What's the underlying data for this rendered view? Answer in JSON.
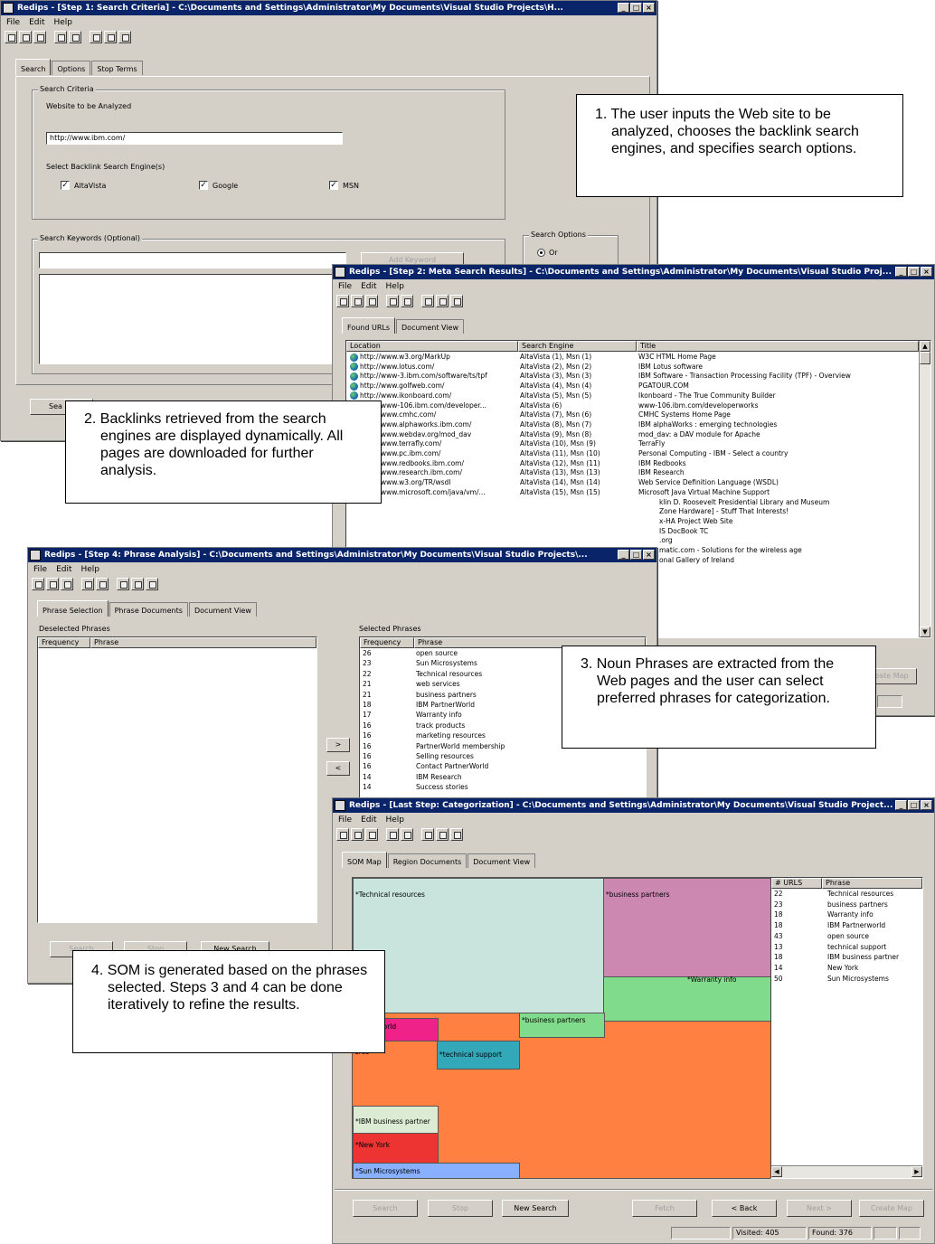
{
  "win1": {
    "title": "Redips - [Step 1: Search Criteria] - C:\\Documents and Settings\\Administrator\\My Documents\\Visual Studio Projects\\H...",
    "menu": [
      "File",
      "Edit",
      "Help"
    ],
    "tabs": [
      "Search",
      "Options",
      "Stop Terms"
    ],
    "criteria_group": "Search Criteria",
    "website_label": "Website to be Analyzed",
    "website_value": "http://www.ibm.com/",
    "engines_label": "Select Backlink Search Engine(s)",
    "engines": [
      "AltaVista",
      "Google",
      "MSN"
    ],
    "keywords_group": "Search Keywords (Optional)",
    "add_keyword": "Add Keyword",
    "options_group": "Search Options",
    "option_or": "Or",
    "bottom_button": "Sea"
  },
  "win2": {
    "title": "Redips - [Step 2: Meta Search Results] - C:\\Documents and Settings\\Administrator\\My Documents\\Visual Studio Proj...",
    "menu": [
      "File",
      "Edit",
      "Help"
    ],
    "tabs": [
      "Found URLs",
      "Document View"
    ],
    "columns": [
      "Location",
      "Search Engine",
      "Title"
    ],
    "rows": [
      {
        "loc": "http://www.w3.org/MarkUp",
        "eng": "AltaVista (1), Msn (1)",
        "title": "W3C HTML Home Page"
      },
      {
        "loc": "http://www.lotus.com/",
        "eng": "AltaVista (2), Msn (2)",
        "title": "IBM Lotus software"
      },
      {
        "loc": "http://www-3.ibm.com/software/ts/tpf",
        "eng": "AltaVista (3), Msn (3)",
        "title": "IBM Software - Transaction Processing Facility (TPF) - Overview"
      },
      {
        "loc": "http://www.golfweb.com/",
        "eng": "AltaVista (4), Msn (4)",
        "title": "PGATOUR.COM"
      },
      {
        "loc": "http://www.ikonboard.com/",
        "eng": "AltaVista (5), Msn (5)",
        "title": "Ikonboard - The True Community Builder"
      },
      {
        "loc": "http://www-106.ibm.com/developer...",
        "eng": "AltaVista (6)",
        "title": "www-106.ibm.com/developerworks"
      },
      {
        "loc": "http://www.cmhc.com/",
        "eng": "AltaVista (7), Msn (6)",
        "title": "CMHC Systems Home Page"
      },
      {
        "loc": "http://www.alphaworks.ibm.com/",
        "eng": "AltaVista (8), Msn (7)",
        "title": "IBM alphaWorks : emerging technologies"
      },
      {
        "loc": "http://www.webdav.org/mod_dav",
        "eng": "AltaVista (9), Msn (8)",
        "title": "mod_dav: a DAV module for Apache"
      },
      {
        "loc": "http://www.terrafly.com/",
        "eng": "AltaVista (10), Msn (9)",
        "title": "TerraFly"
      },
      {
        "loc": "http://www.pc.ibm.com/",
        "eng": "AltaVista (11), Msn (10)",
        "title": "Personal Computing - IBM - Select a country"
      },
      {
        "loc": "http://www.redbooks.ibm.com/",
        "eng": "AltaVista (12), Msn (11)",
        "title": "IBM Redbooks"
      },
      {
        "loc": "http://www.research.ibm.com/",
        "eng": "AltaVista (13), Msn (13)",
        "title": "IBM Research"
      },
      {
        "loc": "http://www.w3.org/TR/wsdl",
        "eng": "AltaVista (14), Msn (14)",
        "title": "Web Service Definition Language (WSDL)"
      },
      {
        "loc": "http://www.microsoft.com/java/vm/...",
        "eng": "AltaVista (15), Msn (15)",
        "title": "Microsoft Java Virtual Machine Support"
      }
    ],
    "more_titles": [
      "klin D. Roosevelt Presidential Library and Museum",
      "Zone Hardware] - Stuff That Interests!",
      "x-HA Project Web Site",
      "IS DocBook TC",
      ".org",
      "matic.com - Solutions for the wireless age",
      "onal Gallery of Ireland"
    ],
    "create_map": "eate Map"
  },
  "win3": {
    "title": "Redips - [Step 4: Phrase Analysis] - C:\\Documents and Settings\\Administrator\\My Documents\\Visual Studio Projects\\...",
    "menu": [
      "File",
      "Edit",
      "Help"
    ],
    "tabs": [
      "Phrase Selection",
      "Phrase Documents",
      "Document View"
    ],
    "deselected_label": "Deselected Phrases",
    "selected_label": "Selected Phrases",
    "columns": [
      "Frequency",
      "Phrase"
    ],
    "selected": [
      {
        "f": "26",
        "p": "open source"
      },
      {
        "f": "23",
        "p": "Sun Microsystems"
      },
      {
        "f": "22",
        "p": "Technical resources"
      },
      {
        "f": "21",
        "p": "web services"
      },
      {
        "f": "21",
        "p": "business partners"
      },
      {
        "f": "18",
        "p": "IBM PartnerWorld"
      },
      {
        "f": "17",
        "p": "Warranty info"
      },
      {
        "f": "16",
        "p": "track products"
      },
      {
        "f": "16",
        "p": "marketing resources"
      },
      {
        "f": "16",
        "p": "PartnerWorld membership"
      },
      {
        "f": "16",
        "p": "Selling resources"
      },
      {
        "f": "16",
        "p": "Contact PartnerWorld"
      },
      {
        "f": "14",
        "p": "IBM Research"
      },
      {
        "f": "14",
        "p": "Success stories"
      }
    ],
    "move_right": ">",
    "move_left": "<",
    "buttons": [
      "Search",
      "Stop",
      "New Search"
    ]
  },
  "win4": {
    "title": "Redips - [Last Step: Categorization] - C:\\Documents and Settings\\Administrator\\My Documents\\Visual Studio Project...",
    "menu": [
      "File",
      "Edit",
      "Help"
    ],
    "tabs": [
      "SOM Map",
      "Region Documents",
      "Document View"
    ],
    "regions": [
      {
        "label": "*Technical resources",
        "color": "#c8e4dc"
      },
      {
        "label": "*business partners",
        "color": "#cc88b0"
      },
      {
        "label": "*Warranty info",
        "color": "#80dc8c"
      },
      {
        "label": "*business partners",
        "color": "#80dc8c"
      },
      {
        "label": "rtnerworld",
        "color": "#ee2288"
      },
      {
        "label": "urce",
        "color": "#ff8040"
      },
      {
        "label": "*technical support",
        "color": "#33a8b8"
      },
      {
        "label": "",
        "color": "#ff8040"
      },
      {
        "label": "*IBM business partner",
        "color": "#dcecd4"
      },
      {
        "label": "*New York",
        "color": "#ee3333"
      },
      {
        "label": "*Sun Microsystems",
        "color": "#88b0ff"
      }
    ],
    "legend_columns": [
      "# URLS",
      "Phrase"
    ],
    "legend": [
      {
        "n": "22",
        "p": "Technical resources"
      },
      {
        "n": "23",
        "p": "business partners"
      },
      {
        "n": "18",
        "p": "Warranty info"
      },
      {
        "n": "18",
        "p": "IBM Partnerworld"
      },
      {
        "n": "43",
        "p": "open source"
      },
      {
        "n": "13",
        "p": "technical support"
      },
      {
        "n": "18",
        "p": "IBM business partner"
      },
      {
        "n": "14",
        "p": "New York"
      },
      {
        "n": "50",
        "p": "Sun Microsystems"
      }
    ],
    "buttons": {
      "search": "Search",
      "stop": "Stop",
      "new_search": "New Search",
      "fetch": "Fetch",
      "back": "< Back",
      "next": "Next >",
      "create_map": "Create Map"
    },
    "status_visited": "Visited: 405",
    "status_found": "Found: 376"
  },
  "callouts": {
    "c1": "1. The user inputs the Web site to be analyzed, chooses the backlink search engines, and specifies search options.",
    "c2": "2. Backlinks retrieved from the search engines are displayed dynamically. All pages are downloaded for further analysis.",
    "c3": "3. Noun Phrases are extracted from the Web pages and the user can select preferred phrases for categorization.",
    "c4": "4. SOM is generated based on the phrases selected. Steps 3 and 4 can be done iteratively to refine the results."
  },
  "icons": {
    "app": "app-icon",
    "globe": "globe-icon",
    "check": "checkmark"
  },
  "colors": {
    "titlebar": "#0a246a",
    "face": "#d4d0c8"
  }
}
